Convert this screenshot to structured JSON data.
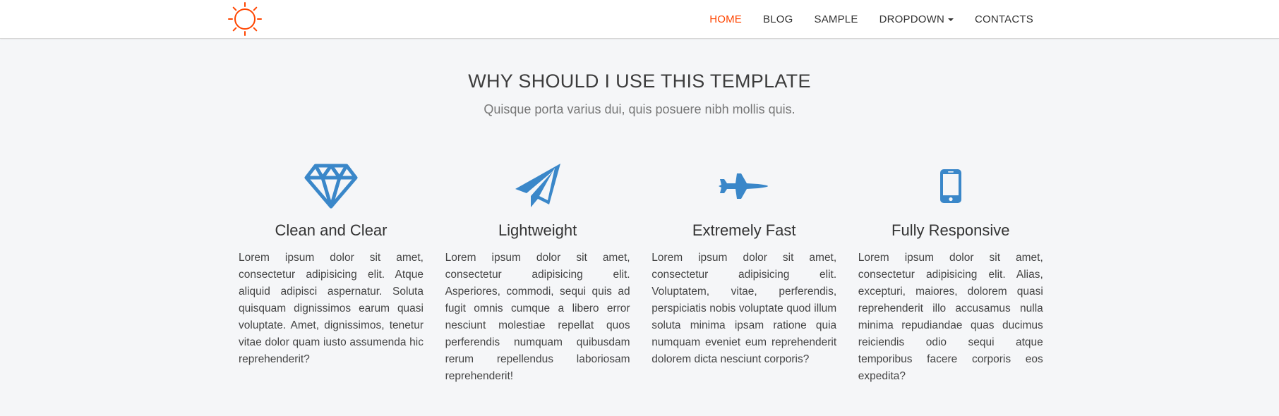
{
  "nav": {
    "logo_icon": "sun-icon",
    "accent_color": "#ff4500",
    "items": [
      {
        "label": "HOME",
        "active": true
      },
      {
        "label": "BLOG"
      },
      {
        "label": "SAMPLE"
      },
      {
        "label": "DROPDOWN",
        "has_caret": true
      },
      {
        "label": "CONTACTS"
      }
    ]
  },
  "intro": {
    "title": "WHY SHOULD I USE THIS TEMPLATE",
    "subtitle": "Quisque porta varius dui, quis posuere nibh mollis quis."
  },
  "features": {
    "icon_color": "#3a87c9",
    "items": [
      {
        "icon": "diamond-icon",
        "title": "Clean and Clear",
        "text": "Lorem ipsum dolor sit amet, consectetur adipisicing elit. Atque aliquid adipisci aspernatur. Soluta quisquam dignissimos earum quasi voluptate. Amet, dignissimos, tenetur vitae dolor quam iusto assumenda hic reprehenderit?"
      },
      {
        "icon": "paper-plane-icon",
        "title": "Lightweight",
        "text": "Lorem ipsum dolor sit amet, consectetur adipisicing elit. Asperiores, commodi, sequi quis ad fugit omnis cumque a libero error nesciunt molestiae repellat quos perferendis numquam quibusdam rerum repellendus laboriosam reprehenderit!"
      },
      {
        "icon": "fighter-jet-icon",
        "title": "Extremely Fast",
        "text": "Lorem ipsum dolor sit amet, consectetur adipisicing elit. Voluptatem, vitae, perferendis, perspiciatis nobis voluptate quod illum soluta minima ipsam ratione quia numquam eveniet eum reprehenderit dolorem dicta nesciunt corporis?"
      },
      {
        "icon": "mobile-phone-icon",
        "title": "Fully Responsive",
        "text": "Lorem ipsum dolor sit amet, consectetur adipisicing elit. Alias, excepturi, maiores, dolorem quasi reprehenderit illo accusamus nulla minima repudiandae quas ducimus reiciendis odio sequi atque temporibus facere corporis eos expedita?"
      }
    ]
  }
}
